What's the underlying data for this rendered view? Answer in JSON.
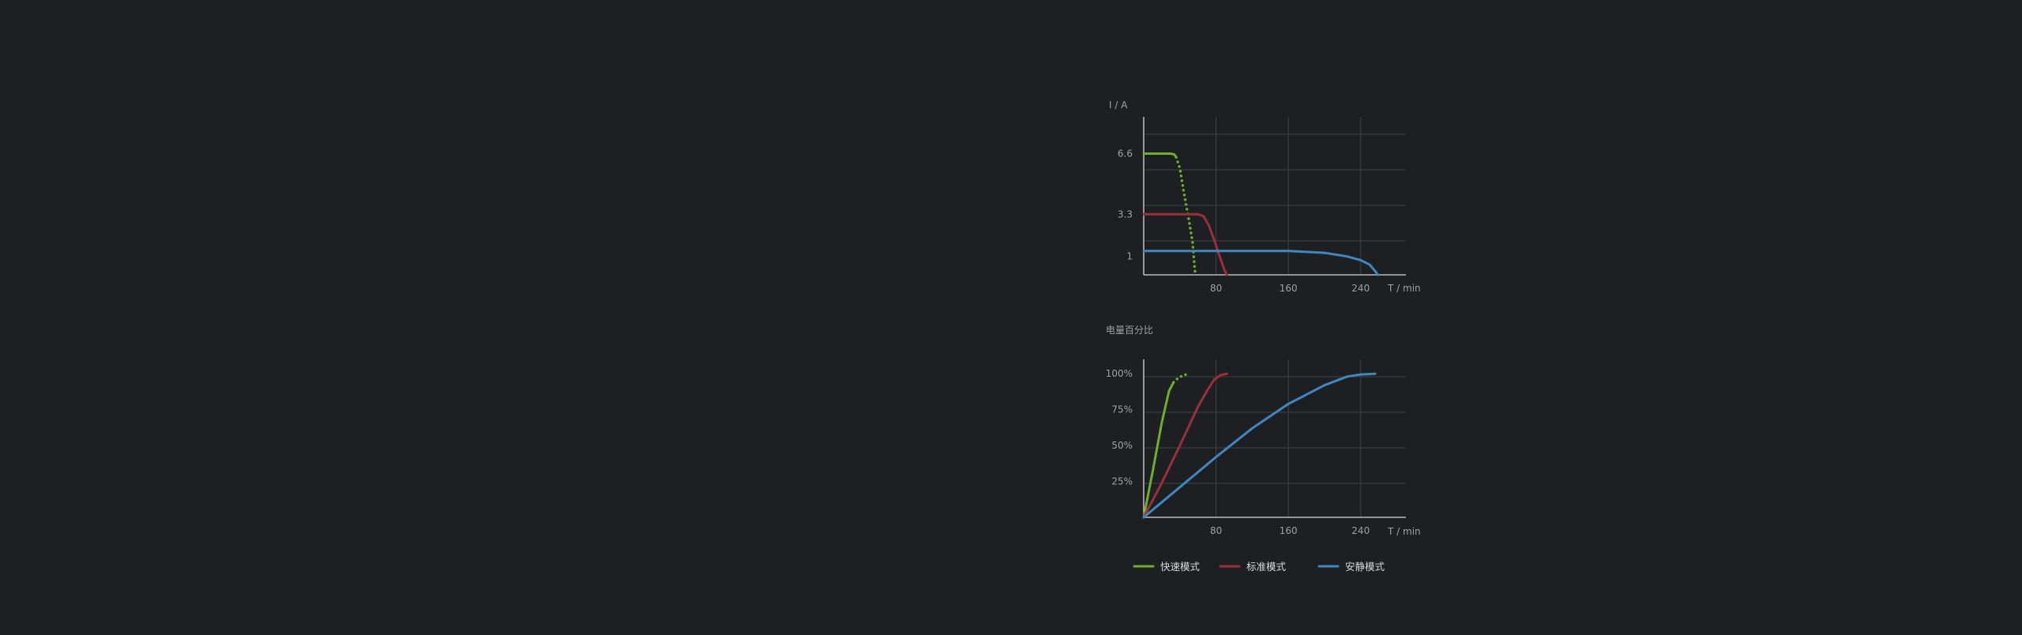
{
  "chart_data": [
    {
      "type": "line",
      "ylabel": "I / A",
      "xlabel": "T / min",
      "xlim": [
        0,
        290
      ],
      "ylim": [
        0,
        8.6
      ],
      "x_ticks": [
        80,
        160,
        240
      ],
      "y_ticks": [
        1,
        3.3,
        6.6
      ],
      "y_tick_labels": [
        "1",
        "3.3",
        "6.6"
      ],
      "grid": true,
      "series": [
        {
          "key": "fast",
          "segments": [
            {
              "style": "solid",
              "points": [
                [
                  0,
                  6.6
                ],
                [
                  30,
                  6.6
                ],
                [
                  34,
                  6.55
                ],
                [
                  36,
                  6.4
                ]
              ]
            },
            {
              "style": "dotted",
              "points": [
                [
                  36,
                  6.4
                ],
                [
                  40,
                  5.8
                ],
                [
                  44,
                  4.6
                ],
                [
                  50,
                  3.0
                ],
                [
                  54,
                  1.8
                ],
                [
                  56,
                  0.6
                ],
                [
                  57,
                  0
                ]
              ]
            }
          ]
        },
        {
          "key": "standard",
          "segments": [
            {
              "style": "solid",
              "points": [
                [
                  0,
                  3.3
                ],
                [
                  60,
                  3.3
                ],
                [
                  66,
                  3.2
                ],
                [
                  72,
                  2.7
                ],
                [
                  78,
                  1.9
                ],
                [
                  84,
                  1.0
                ],
                [
                  89,
                  0.3
                ],
                [
                  92,
                  0
                ]
              ]
            }
          ]
        },
        {
          "key": "quiet",
          "segments": [
            {
              "style": "solid",
              "points": [
                [
                  0,
                  1.3
                ],
                [
                  160,
                  1.3
                ],
                [
                  200,
                  1.2
                ],
                [
                  225,
                  1.0
                ],
                [
                  240,
                  0.8
                ],
                [
                  250,
                  0.55
                ],
                [
                  256,
                  0.2
                ],
                [
                  259,
                  0
                ]
              ]
            }
          ]
        }
      ]
    },
    {
      "type": "line",
      "ylabel": "电量百分比",
      "xlabel": "T / min",
      "xlim": [
        0,
        290
      ],
      "ylim": [
        0,
        110
      ],
      "x_ticks": [
        80,
        160,
        240
      ],
      "y_ticks": [
        25,
        50,
        75,
        100
      ],
      "y_tick_labels": [
        "25%",
        "50%",
        "75%",
        "100%"
      ],
      "grid": true,
      "series": [
        {
          "key": "fast",
          "segments": [
            {
              "style": "solid",
              "points": [
                [
                  0,
                  0
                ],
                [
                  10,
                  32
                ],
                [
                  20,
                  66
                ],
                [
                  28,
                  88
                ],
                [
                  33,
                  94
                ]
              ]
            },
            {
              "style": "dotted",
              "points": [
                [
                  33,
                  94
                ],
                [
                  38,
                  97
                ],
                [
                  44,
                  99
                ],
                [
                  50,
                  100
                ]
              ]
            }
          ]
        },
        {
          "key": "standard",
          "segments": [
            {
              "style": "solid",
              "points": [
                [
                  0,
                  0
                ],
                [
                  20,
                  24
                ],
                [
                  40,
                  50
                ],
                [
                  60,
                  77
                ],
                [
                  70,
                  88
                ],
                [
                  78,
                  96
                ],
                [
                  85,
                  99
                ],
                [
                  92,
                  100
                ]
              ]
            }
          ]
        },
        {
          "key": "quiet",
          "segments": [
            {
              "style": "solid",
              "points": [
                [
                  0,
                  0
                ],
                [
                  40,
                  21
                ],
                [
                  80,
                  42
                ],
                [
                  120,
                  62
                ],
                [
                  160,
                  79
                ],
                [
                  200,
                  92
                ],
                [
                  225,
                  98
                ],
                [
                  240,
                  99.5
                ],
                [
                  256,
                  100
                ]
              ]
            }
          ]
        }
      ]
    }
  ],
  "legend": {
    "placement": "bottom",
    "items": [
      {
        "key": "fast",
        "label": "快速模式",
        "color": "#6fae2c"
      },
      {
        "key": "standard",
        "label": "标准模式",
        "color": "#9b2f3c"
      },
      {
        "key": "quiet",
        "label": "安静模式",
        "color": "#3f87bd"
      }
    ]
  },
  "colors": {
    "background": "#1d1f23",
    "grid": "#3f4247",
    "axis": "#d9dadc"
  }
}
